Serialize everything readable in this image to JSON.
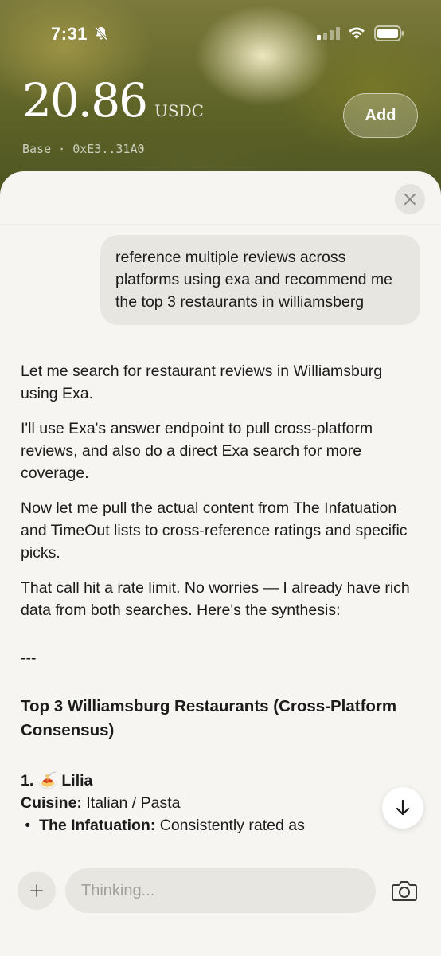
{
  "status_bar": {
    "time": "7:31"
  },
  "wallet": {
    "balance": "20.86",
    "unit": "USDC",
    "network_line": "Base · 0xE3..31A0",
    "add_label": "Add"
  },
  "chat": {
    "user_message": "reference multiple reviews across platforms using exa and recommend me the top 3 restaurants in williamsberg",
    "assistant": {
      "p1": "Let me search for restaurant reviews in Williamsburg using Exa.",
      "p2": "I'll use Exa's answer endpoint to pull cross-platform reviews, and also do a direct Exa search for more coverage.",
      "p3": "Now let me pull the actual content from The Infatuation and TimeOut lists to cross-reference ratings and specific picks.",
      "p4": "That call hit a rate limit. No worries — I already have rich data from both searches. Here's the synthesis:",
      "separator": "---",
      "heading": "Top 3 Williamsburg Restaurants (Cross-Platform Consensus)",
      "item1_number": "1.",
      "item1_emoji": "🍝",
      "item1_name": "Lilia",
      "cuisine_label": "Cuisine:",
      "cuisine_value": "Italian / Pasta",
      "bullet_label": "The Infatuation:",
      "bullet_text": "Consistently rated as"
    }
  },
  "composer": {
    "placeholder": "Thinking..."
  },
  "icons": {
    "close": "close-icon",
    "scroll_down": "arrow-down-icon",
    "attach": "plus-icon",
    "camera": "camera-icon"
  }
}
